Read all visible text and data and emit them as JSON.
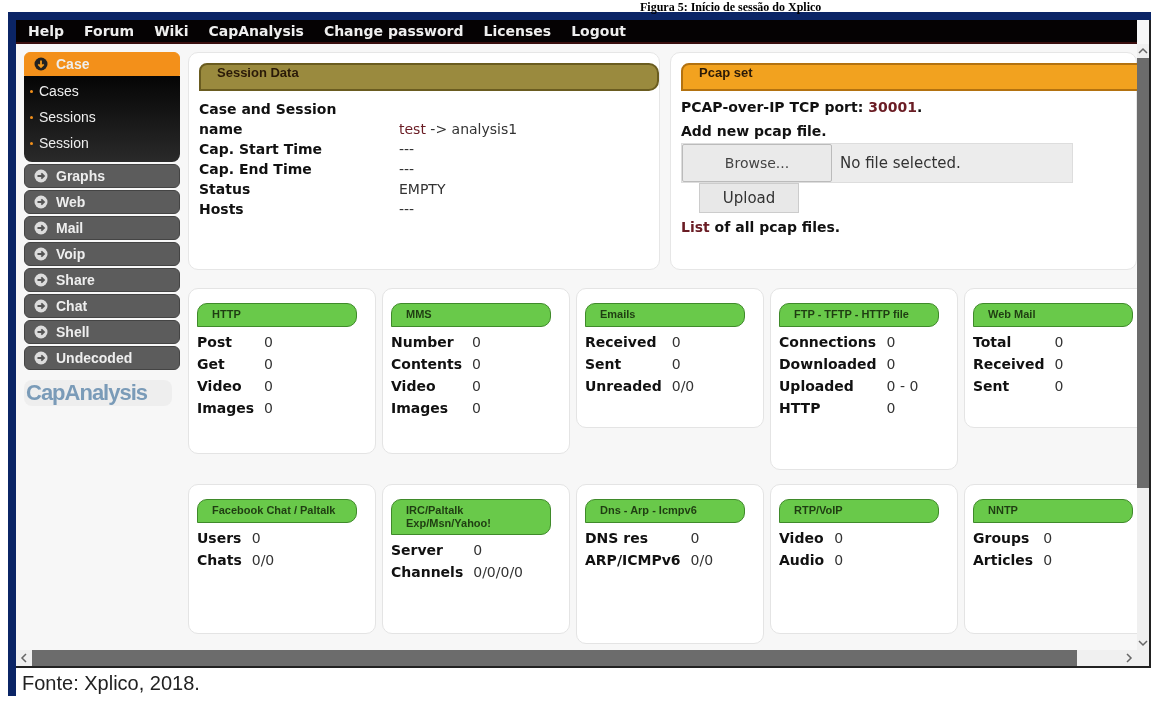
{
  "caption": "Figura 5: Início de sessão do Xplico",
  "menu": [
    "Help",
    "Forum",
    "Wiki",
    "CapAnalysis",
    "Change password",
    "Licenses",
    "Logout"
  ],
  "sidebar": {
    "items": [
      {
        "label": "Case",
        "expanded": true,
        "children": [
          {
            "label": "Cases"
          },
          {
            "label": "Sessions"
          },
          {
            "label": "Session"
          }
        ]
      },
      {
        "label": "Graphs",
        "expanded": false
      },
      {
        "label": "Web",
        "expanded": false
      },
      {
        "label": "Mail",
        "expanded": false
      },
      {
        "label": "Voip",
        "expanded": false
      },
      {
        "label": "Share",
        "expanded": false
      },
      {
        "label": "Chat",
        "expanded": false
      },
      {
        "label": "Shell",
        "expanded": false
      },
      {
        "label": "Undecoded",
        "expanded": false
      }
    ],
    "logo": "CapAnalysis"
  },
  "session_data": {
    "title": "Session Data",
    "rows": [
      {
        "label": "Case and Session name",
        "link": "test",
        "value": "-> analysis1"
      },
      {
        "label": "Cap. Start Time",
        "value": "---"
      },
      {
        "label": "Cap. End Time",
        "value": "---"
      },
      {
        "label": "Status",
        "value": "EMPTY"
      },
      {
        "label": "Hosts",
        "value": "---"
      }
    ]
  },
  "pcap_set": {
    "title": "Pcap set",
    "port_label": "PCAP-over-IP TCP port:",
    "port": "30001",
    "port_end": ".",
    "add_label": "Add new pcap file.",
    "browse_button": "Browse...",
    "file_status": "No file selected.",
    "upload_button": "Upload",
    "list_link": "List",
    "list_text": "of all pcap files."
  },
  "cards": [
    {
      "title": "HTTP",
      "rows": [
        {
          "label": "Post",
          "value": "0"
        },
        {
          "label": "Get",
          "value": "0"
        },
        {
          "label": "Video",
          "value": "0"
        },
        {
          "label": "Images",
          "value": "0"
        }
      ]
    },
    {
      "title": "MMS",
      "rows": [
        {
          "label": "Number",
          "value": "0"
        },
        {
          "label": "Contents",
          "value": "0"
        },
        {
          "label": "Video",
          "value": "0"
        },
        {
          "label": "Images",
          "value": "0"
        }
      ]
    },
    {
      "title": "Emails",
      "rows": [
        {
          "label": "Received",
          "value": "0"
        },
        {
          "label": "Sent",
          "value": "0"
        },
        {
          "label": "Unreaded",
          "value": "0/0"
        }
      ]
    },
    {
      "title": "FTP - TFTP - HTTP file",
      "rows": [
        {
          "label": "Connections",
          "value": "0"
        },
        {
          "label": "Downloaded",
          "value": "0"
        },
        {
          "label": "Uploaded",
          "value": "0 - 0"
        },
        {
          "label": "HTTP",
          "value": "0"
        }
      ]
    },
    {
      "title": "Web Mail",
      "rows": [
        {
          "label": "Total",
          "value": "0"
        },
        {
          "label": "Received",
          "value": "0"
        },
        {
          "label": "Sent",
          "value": "0"
        }
      ]
    },
    {
      "title": "Facebook Chat / Paltalk",
      "rows": [
        {
          "label": "Users",
          "value": "0"
        },
        {
          "label": "Chats",
          "value": "0/0"
        }
      ]
    },
    {
      "title": "IRC/Paltalk Exp/Msn/Yahoo!",
      "rows": [
        {
          "label": "Server",
          "value": "0"
        },
        {
          "label": "Channels",
          "value": "0/0/0/0"
        }
      ]
    },
    {
      "title": "Dns - Arp - Icmpv6",
      "rows": [
        {
          "label": "DNS res",
          "value": "0"
        },
        {
          "label": "ARP/ICMPv6",
          "value": "0/0"
        }
      ]
    },
    {
      "title": "RTP/VoIP",
      "rows": [
        {
          "label": "Video",
          "value": "0"
        },
        {
          "label": "Audio",
          "value": "0"
        }
      ]
    },
    {
      "title": "NNTP",
      "rows": [
        {
          "label": "Groups",
          "value": "0"
        },
        {
          "label": "Articles",
          "value": "0"
        }
      ]
    }
  ],
  "footer": "Fonte: Xplico, 2018."
}
